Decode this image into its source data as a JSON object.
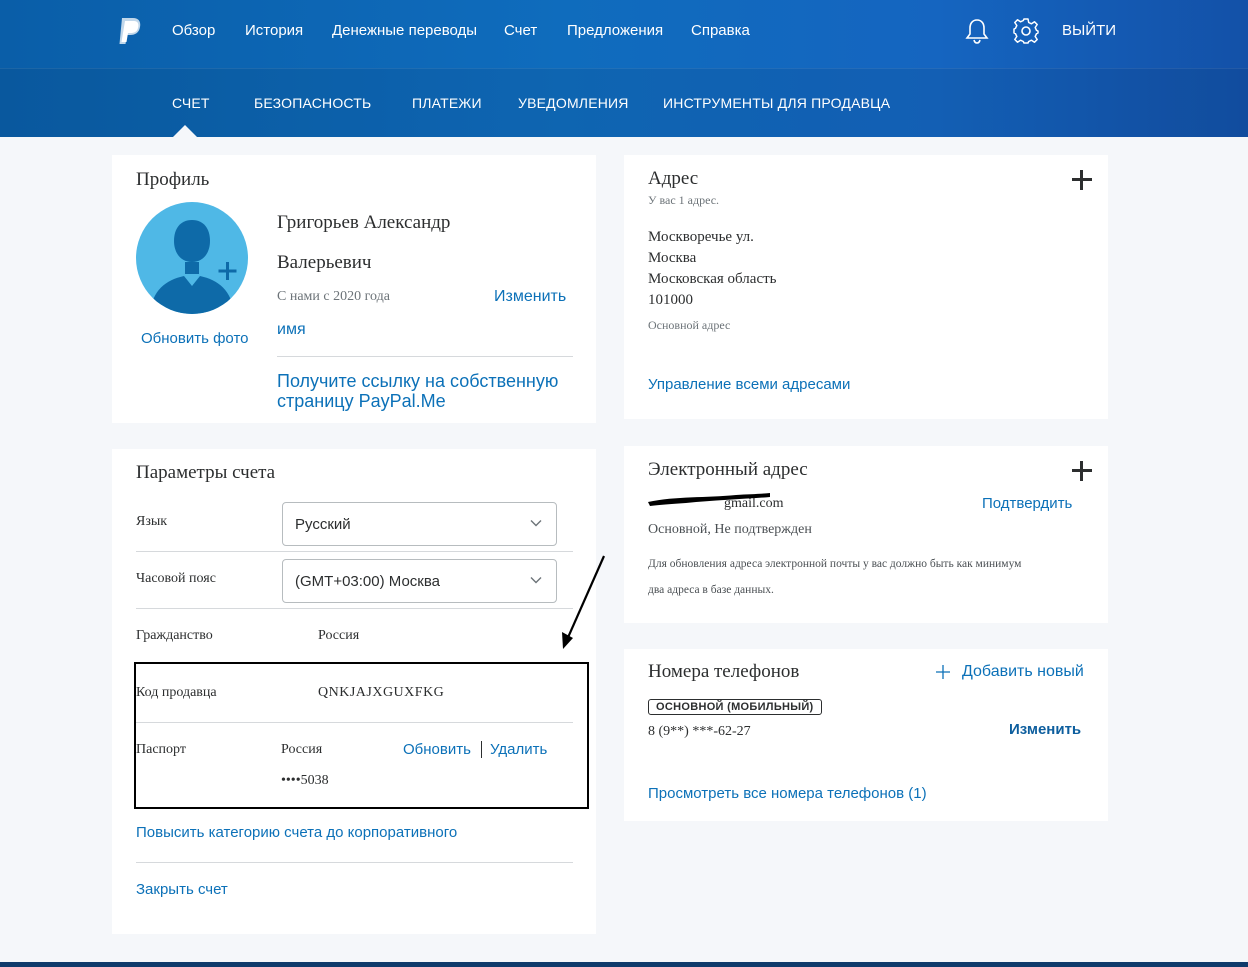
{
  "nav": {
    "items": [
      "Обзор",
      "История",
      "Денежные переводы",
      "Счет",
      "Предложения",
      "Справка"
    ],
    "logout": "ВЫЙТИ"
  },
  "subnav": {
    "items": [
      "СЧЕТ",
      "БЕЗОПАСНОСТЬ",
      "ПЛАТЕЖИ",
      "УВЕДОМЛЕНИЯ",
      "ИНСТРУМЕНТЫ ДЛЯ ПРОДАВЦА"
    ],
    "active": "СЧЕТ"
  },
  "profile": {
    "title": "Профиль",
    "name_line1": "Григорьев Александр",
    "name_line2": "Валерьевич",
    "since": "С нами с 2020 года",
    "change_name_1": "Изменить",
    "change_name_2": "имя",
    "update_photo": "Обновить фото",
    "paypalme_line1": "Получите ссылку на собственную",
    "paypalme_line2": "страницу PayPal.Me"
  },
  "settings": {
    "title": "Параметры счета",
    "language_label": "Язык",
    "language_value": "Русский",
    "timezone_label": "Часовой пояс",
    "timezone_value": "(GMT+03:00) Москва",
    "citizenship_label": "Гражданство",
    "citizenship_value": "Россия",
    "merchant_label": "Код продавца",
    "merchant_value": "QNKJAJXGUXFKG",
    "passport_label": "Паспорт",
    "passport_country": "Россия",
    "passport_number": "••••5038",
    "passport_update": "Обновить",
    "passport_delete": "Удалить",
    "upgrade": "Повысить категорию счета до корпоративного",
    "close": "Закрыть счет"
  },
  "address": {
    "title": "Адрес",
    "count": "У вас 1 адрес.",
    "line1": "Москворечье ул.",
    "line2": "Москва",
    "line3": "Московская область",
    "line4": "101000",
    "primary": "Основной адрес",
    "manage": "Управление всеми адресами"
  },
  "email": {
    "title": "Электронный адрес",
    "address_visible": "gmail.com",
    "confirm": "Подтвердить",
    "status": "Основной, Не подтвержден",
    "note_line1": "Для обновления адреса электронной почты у вас должно быть как минимум",
    "note_line2": "два адреса в базе данных."
  },
  "phones": {
    "title": "Номера телефонов",
    "add": "Добавить новый",
    "badge": "ОСНОВНОЙ (МОБИЛЬНЫЙ)",
    "number": "8 (9**) ***-62-27",
    "change": "Изменить",
    "view_all": "Просмотреть все номера телефонов (1)"
  },
  "colors": {
    "brand_blue": "#0f6cbd",
    "link_blue": "#0c71b8",
    "avatar_blue": "#4fb8e6"
  }
}
